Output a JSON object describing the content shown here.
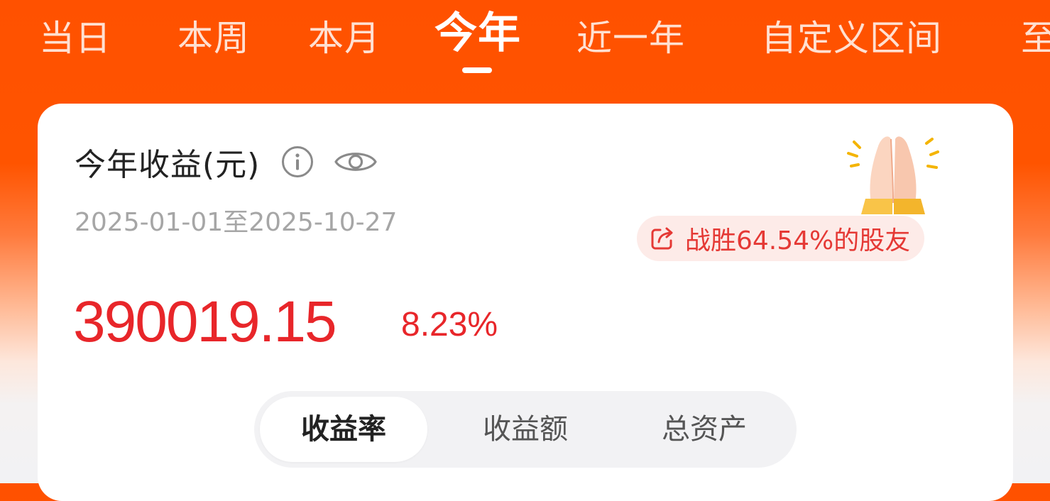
{
  "tabs": [
    {
      "label": "当日",
      "active": false
    },
    {
      "label": "本周",
      "active": false
    },
    {
      "label": "本月",
      "active": false
    },
    {
      "label": "今年",
      "active": true
    },
    {
      "label": "近一年",
      "active": false
    },
    {
      "label": "自定义区间",
      "active": false
    },
    {
      "label": "至",
      "active": false
    }
  ],
  "card": {
    "title": "今年收益(元)",
    "date_range": "2025-01-01至2025-10-27",
    "profit_value": "390019.15",
    "profit_rate": "8.23%",
    "beat_text": "战胜64.54%的股友"
  },
  "segments": [
    {
      "label": "收益率",
      "active": true
    },
    {
      "label": "收益额",
      "active": false
    },
    {
      "label": "总资产",
      "active": false
    }
  ],
  "colors": {
    "header_orange": "#FF5100",
    "profit_red": "#E8262A",
    "badge_bg": "#FDEBE8",
    "badge_text": "#E53935"
  },
  "icons": {
    "info": "info-circle-icon",
    "visibility": "eye-icon",
    "share": "share-icon",
    "illustration": "clapping-hands-icon"
  }
}
